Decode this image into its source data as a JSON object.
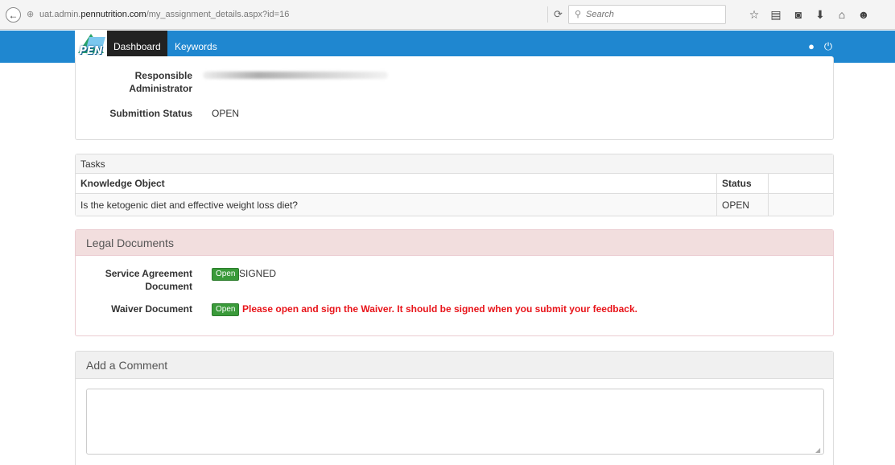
{
  "browser": {
    "url_prefix": "uat.admin.",
    "url_domain": "pennutrition.com",
    "url_path": "/my_assignment_details.aspx?id=16",
    "search_placeholder": "Search",
    "reload_glyph": "⟳",
    "back_glyph": "←",
    "globe_glyph": "⊕",
    "search_glyph": "⚲",
    "toolbar_icons": [
      {
        "name": "bookmark-star-icon",
        "glyph": "☆"
      },
      {
        "name": "bookmarks-list-icon",
        "glyph": "▤"
      },
      {
        "name": "pocket-icon",
        "glyph": "◙"
      },
      {
        "name": "download-icon",
        "glyph": "⬇"
      },
      {
        "name": "home-icon",
        "glyph": "⌂"
      },
      {
        "name": "chat-icon",
        "glyph": "☻"
      }
    ]
  },
  "navbar": {
    "logo_text": "PEN",
    "dashboard": "Dashboard",
    "keywords": "Keywords",
    "user_glyph": "●",
    "power_glyph": "⏻",
    "accent": "#1f87d0"
  },
  "assignment": {
    "responsible_label": "Responsible Administrator",
    "status_label": "Submittion Status",
    "status_value": "OPEN"
  },
  "tasks": {
    "title": "Tasks",
    "columns": [
      "Knowledge Object",
      "Status"
    ],
    "rows": [
      {
        "knowledge_object": "Is the ketogenic diet and effective weight loss diet?",
        "status": "OPEN"
      }
    ]
  },
  "legal": {
    "title": "Legal Documents",
    "service_label": "Service Agreement Document",
    "service_button": "Open",
    "service_status": "SIGNED",
    "waiver_label": "Waiver Document",
    "waiver_button": "Open",
    "waiver_warning": "Please open and sign the Waiver. It should be signed when you submit your feedback.",
    "warning_color": "#e8141a"
  },
  "comment": {
    "title": "Add a Comment",
    "value": ""
  }
}
